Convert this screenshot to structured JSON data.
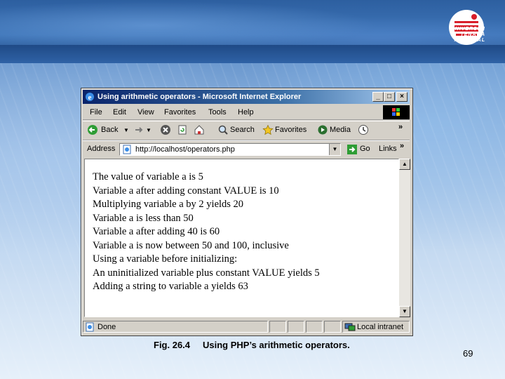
{
  "logo": {
    "text": "UNIVERSITI\nTENAGA\nNASIONAL"
  },
  "window": {
    "title": "Using arithmetic operators - Microsoft Internet Explorer",
    "min": "_",
    "max": "□",
    "close": "×"
  },
  "menu": [
    "File",
    "Edit",
    "View",
    "Favorites",
    "Tools",
    "Help"
  ],
  "toolbar": {
    "back": "Back",
    "search": "Search",
    "favorites": "Favorites",
    "media": "Media",
    "more": "»"
  },
  "address": {
    "label": "Address",
    "value": "http://localhost/operators.php",
    "go": "Go",
    "links": "Links",
    "more": "»"
  },
  "output_lines": [
    "The value of variable a is 5",
    "Variable a after adding constant VALUE is 10",
    "Multiplying variable a by 2 yields 20",
    "Variable a is less than 50",
    "Variable a after adding 40 is 60",
    "Variable a is now between 50 and 100, inclusive",
    "Using a variable before initializing:",
    "An uninitialized variable plus constant VALUE yields 5",
    "Adding a string to variable a yields 63"
  ],
  "status": {
    "text": "Done",
    "zone": "Local intranet"
  },
  "caption": {
    "fig": "Fig. 26.4",
    "text": "Using PHP’s arithmetic operators."
  },
  "page_number": "69",
  "colors": {
    "titlebar": "#0a246a",
    "chrome": "#d4d0c8",
    "slide_blue": "#3e75b8"
  }
}
